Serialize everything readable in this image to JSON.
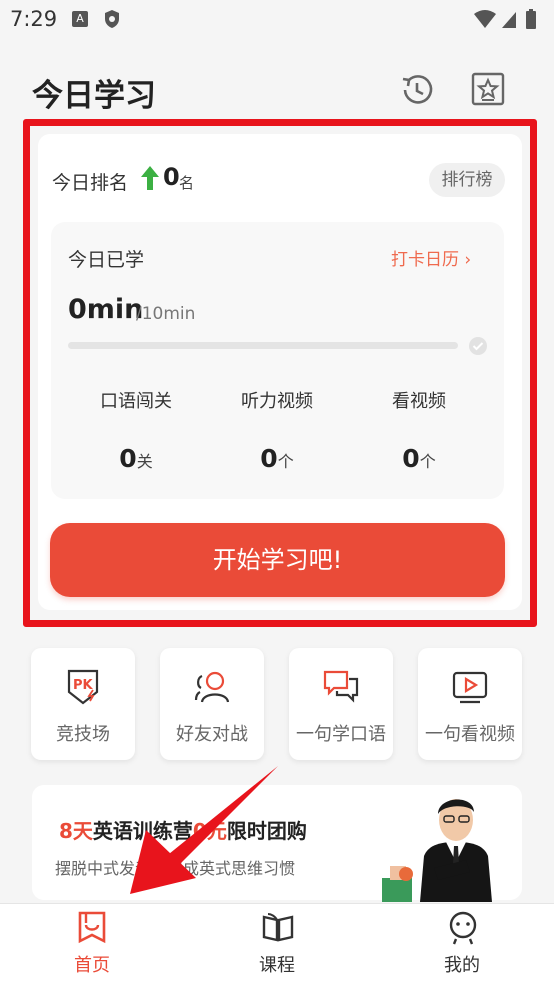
{
  "status_bar": {
    "time": "7:29",
    "a_badge": "A"
  },
  "header": {
    "title": "今日学习",
    "history_icon": "history-clock-icon",
    "favorites_icon": "star-box-icon"
  },
  "rank": {
    "label": "今日排名",
    "value": "0",
    "unit": "名",
    "leaderboard_label": "排行榜"
  },
  "today": {
    "label": "今日已学",
    "calendar_link": "打卡日历 ›",
    "minutes": "0min",
    "goal": "/10min",
    "progress": 0,
    "stats": [
      {
        "label": "口语闯关",
        "value": "0",
        "unit": "关"
      },
      {
        "label": "听力视频",
        "value": "0",
        "unit": "个"
      },
      {
        "label": "看视频",
        "value": "0",
        "unit": "个"
      }
    ]
  },
  "start_button": "开始学习吧!",
  "tiles": [
    {
      "label": "竞技场",
      "icon": "pk-shield-icon"
    },
    {
      "label": "好友对战",
      "icon": "friends-icon"
    },
    {
      "label": "一句学口语",
      "icon": "speech-bubbles-icon"
    },
    {
      "label": "一句看视频",
      "icon": "video-play-icon"
    }
  ],
  "promo": {
    "title_accent": "8天",
    "title_rest_1": "英语训练营",
    "title_hidden": "0元",
    "title_rest_2": "限时团购",
    "subtitle_1": "摆脱中式发音",
    "subtitle_2": "养成英式思维习惯"
  },
  "nav": [
    {
      "label": "首页",
      "icon": "home-bookmark-icon",
      "active": true
    },
    {
      "label": "课程",
      "icon": "open-book-icon",
      "active": false
    },
    {
      "label": "我的",
      "icon": "profile-face-icon",
      "active": false
    }
  ],
  "colors": {
    "accent": "#ea4b38",
    "highlight": "#e8141c",
    "rank_up": "#3cb043"
  }
}
